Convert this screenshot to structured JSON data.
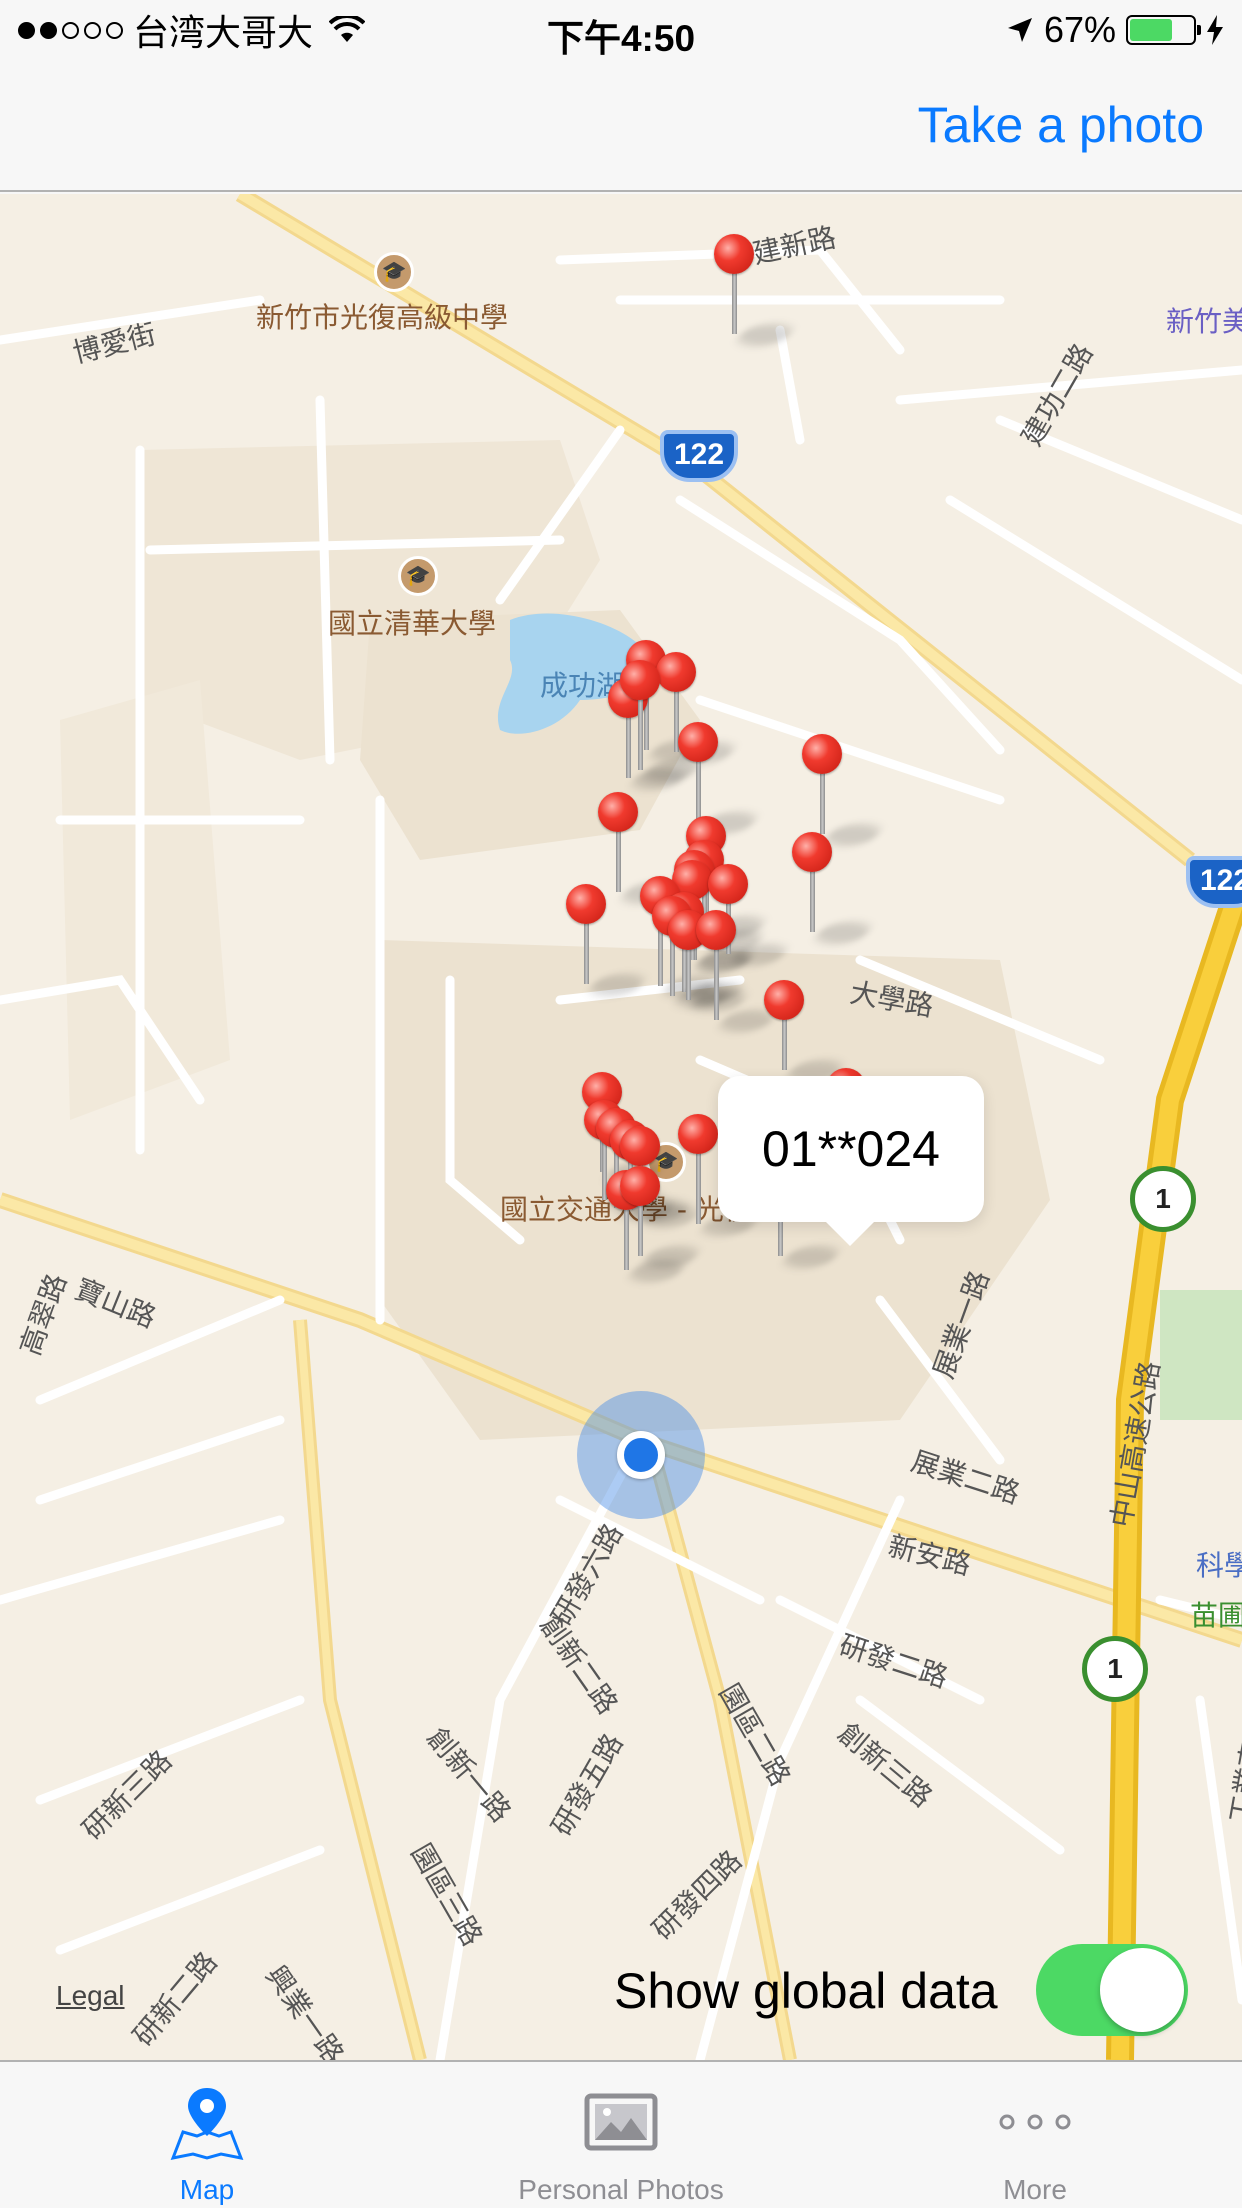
{
  "status_bar": {
    "carrier": "台湾大哥大",
    "time": "下午4:50",
    "battery_percent": "67%",
    "battery_level": 0.67,
    "signal_bars": 2,
    "icons": [
      "signal-dots-icon",
      "wifi-icon",
      "location-arrow-icon",
      "battery-icon",
      "charging-bolt-icon"
    ]
  },
  "nav": {
    "take_photo_label": "Take a photo"
  },
  "map": {
    "road_labels": [
      "建新路",
      "博愛街",
      "建功二路",
      "大學路",
      "展業一路",
      "中山高速公路",
      "展業二路",
      "新安路",
      "研發六路",
      "創新二路",
      "研發二路",
      "寶山路",
      "高翠路",
      "園區二路",
      "創新三路",
      "創新一路",
      "研發五路",
      "研新三路",
      "研發四路",
      "園區三路",
      "研新二路",
      "興業一路",
      "工業東二路"
    ],
    "places": [
      "新竹市光復高級中學",
      "國立清華大學",
      "成功湖",
      "國立交通大學 - 光復校區",
      "新竹美",
      "苗圃",
      "科學"
    ],
    "highway_shields": [
      "122",
      "122"
    ],
    "route_markers": [
      "1",
      "1"
    ],
    "pin_count": 31,
    "callout_text": "01**024",
    "legal_label": "Legal",
    "accent_pin_color": "#e8281d",
    "user_location_color": "#1f76e6"
  },
  "global_toggle": {
    "label": "Show global data",
    "on": true,
    "on_color": "#4cd964"
  },
  "tabs": [
    {
      "label": "Map",
      "icon": "map-pin-icon",
      "active": true
    },
    {
      "label": "Personal Photos",
      "icon": "photo-frame-icon",
      "active": false
    },
    {
      "label": "More",
      "icon": "more-dots-icon",
      "active": false
    }
  ],
  "colors": {
    "tint": "#0a7aff",
    "inactive_tab": "#8e8e93"
  }
}
